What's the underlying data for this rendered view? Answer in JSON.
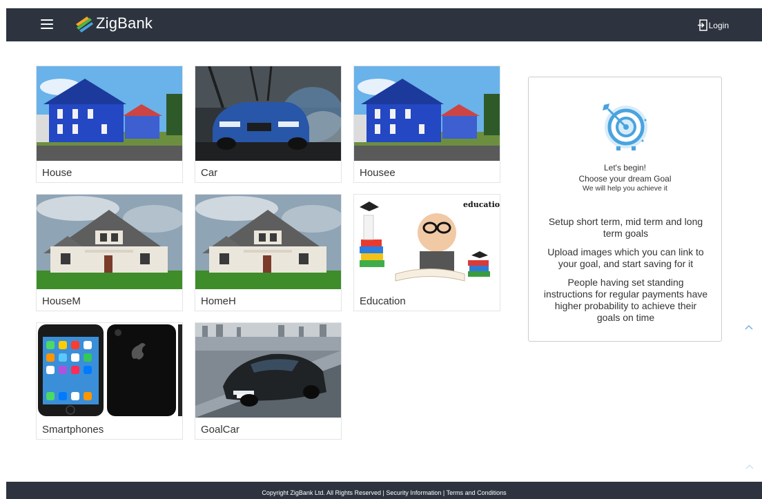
{
  "header": {
    "app_name": "ZigBank",
    "login_label": "Login",
    "icons": {
      "menu": "hamburger-menu-icon",
      "logo": "zigbank-logo-icon",
      "login": "login-icon"
    }
  },
  "goals": [
    {
      "label": "House",
      "image": "blue-house-photo"
    },
    {
      "label": "Car",
      "image": "blue-car-photo"
    },
    {
      "label": "Housee",
      "image": "blue-house-photo"
    },
    {
      "label": "HouseM",
      "image": "grey-house-photo"
    },
    {
      "label": "HomeH",
      "image": "grey-house-photo"
    },
    {
      "label": "Education",
      "image": "education-photo",
      "image_caption": "education"
    },
    {
      "label": "Smartphones",
      "image": "smartphones-photo"
    },
    {
      "label": "GoalCar",
      "image": "sports-car-photo"
    }
  ],
  "info_panel": {
    "icon": "target-icon",
    "line1": "Let's begin!",
    "line2": "Choose your dream Goal",
    "line3": "We will help you achieve it",
    "points": [
      "Setup short term, mid term and long term goals",
      "Upload images which you can link to your goal, and start saving for it",
      "People having set standing instructions for regular payments have higher probability to achieve their goals on time"
    ]
  },
  "footer": {
    "copyright": "Copyright ZigBank Ltd. All Rights Reserved",
    "separator": " | ",
    "security_link": "Security Information",
    "terms_link": "Terms and Conditions"
  },
  "colors": {
    "header_bg": "#2d3440",
    "accent_blue": "#4aa3df",
    "card_border": "#e2e4e8"
  }
}
